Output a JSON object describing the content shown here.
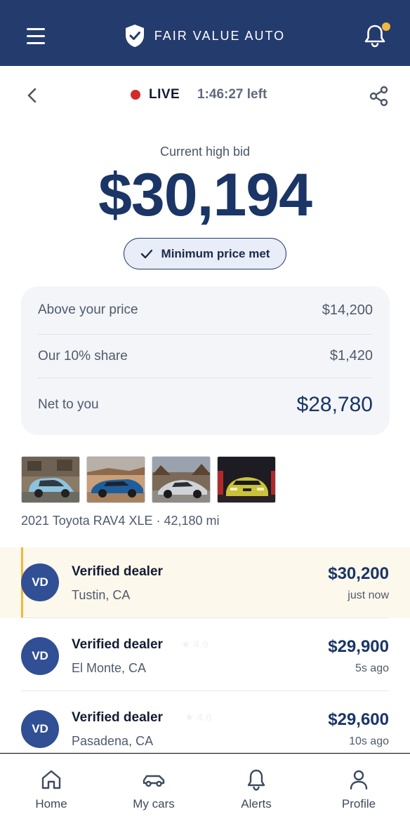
{
  "header": {
    "brand": "FAIR VALUE AUTO",
    "colors": {
      "bar": "#243b6e",
      "notification_dot": "#f2b73a"
    }
  },
  "auction": {
    "status": "LIVE",
    "time_left": "1:46:27 left",
    "current_label": "Current high bid",
    "current_bid": "$30,194",
    "minimum_badge": "Minimum price met"
  },
  "summary": {
    "rows": [
      {
        "label": "Above your price",
        "value": "$14,200"
      },
      {
        "label": "Our 10% share",
        "value": "$1,420"
      },
      {
        "label": "Net to you",
        "value": "$28,780"
      }
    ]
  },
  "vehicle": {
    "photos": [
      "blue-compact-car-photo",
      "blue-coupe-desert-photo",
      "silver-supercar-photo",
      "yellow-sports-car-photo"
    ],
    "info": "2021 Toyota RAV4 XLE · 42,180 mi"
  },
  "bids": [
    {
      "initials": "VD",
      "name": "Verified dealer",
      "rating": "",
      "location": "Tustin, CA",
      "amount": "$30,200",
      "time": "just now"
    },
    {
      "initials": "VD",
      "name": "Verified dealer",
      "rating": "★ 4.9",
      "location": "El Monte, CA",
      "amount": "$29,900",
      "time": "5s ago"
    },
    {
      "initials": "VD",
      "name": "Verified dealer",
      "rating": "★ 4.6",
      "location": "Pasadena, CA",
      "amount": "$29,600",
      "time": "10s ago"
    }
  ],
  "nav": {
    "items": [
      {
        "label": "Home",
        "icon": "home-icon"
      },
      {
        "label": "My cars",
        "icon": "car-icon"
      },
      {
        "label": "Alerts",
        "icon": "bell-icon"
      },
      {
        "label": "Profile",
        "icon": "user-icon"
      }
    ]
  }
}
